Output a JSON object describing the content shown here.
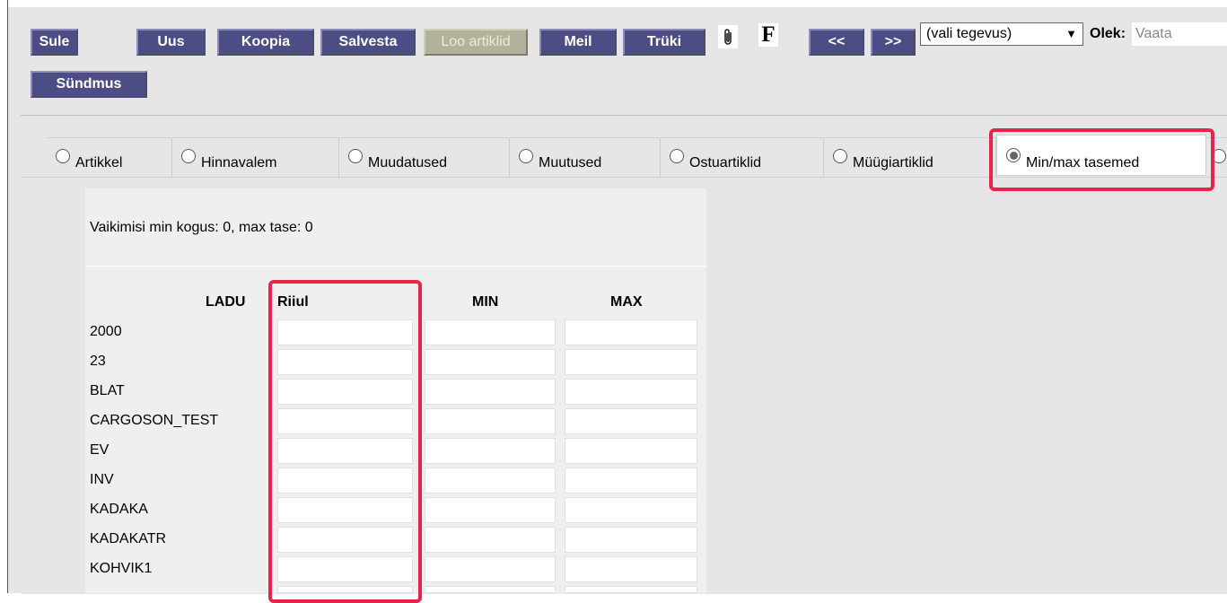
{
  "toolbar": {
    "buttons": {
      "sule": "Sule",
      "uus": "Uus",
      "koopia": "Koopia",
      "salvesta": "Salvesta",
      "loo_artiklid": "Loo artiklid",
      "meil": "Meil",
      "truki": "Trüki",
      "prev": "<<",
      "next": ">>",
      "syndmus": "Sündmus"
    },
    "attachment_icon": "paperclip-icon",
    "f_icon": "F",
    "action_select": "(vali tegevus)",
    "olek_label": "Olek:",
    "olek_value": "Vaata"
  },
  "tabs": [
    {
      "label": "Artikkel",
      "selected": false
    },
    {
      "label": "Hinnavalem",
      "selected": false
    },
    {
      "label": "Muudatused",
      "selected": false
    },
    {
      "label": "Muutused",
      "selected": false
    },
    {
      "label": "Ostuartiklid",
      "selected": false
    },
    {
      "label": "Müügiartiklid",
      "selected": false
    },
    {
      "label": "Min/max tasemed",
      "selected": true
    }
  ],
  "minmax": {
    "default_text": "Vaikimisi min kogus: 0, max tase: 0",
    "headers": {
      "ladu": "LADU",
      "riiul": "Riiul",
      "min": "MIN",
      "max": "MAX"
    },
    "rows": [
      "2000",
      "23",
      "BLAT",
      "CARGOSON_TEST",
      "EV",
      "INV",
      "KADAKA",
      "KADAKATR",
      "KOHVIK1"
    ]
  },
  "colors": {
    "button": "#4d4d86",
    "highlight": "#e8234c"
  }
}
